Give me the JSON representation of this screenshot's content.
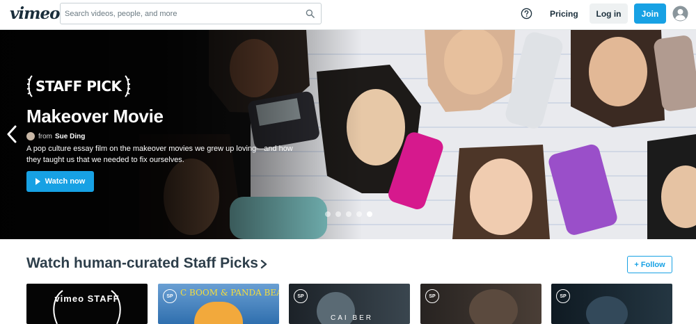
{
  "header": {
    "logo": "vimeo",
    "search_placeholder": "Search videos, people, and more",
    "pricing": "Pricing",
    "login": "Log in",
    "join": "Join"
  },
  "hero": {
    "badge": "STAFF PICK",
    "title": "Makeover Movie",
    "from_label": "from",
    "author": "Sue Ding",
    "description": "A pop culture essay film on the makeover movies we grew up loving—and how they taught us that we needed to fix ourselves.",
    "watch_label": "Watch now",
    "slide_count": 5,
    "active_slide": 5
  },
  "section": {
    "title": "Watch human-curated Staff Picks",
    "follow_label": "+ Follow"
  },
  "thumbnails": [
    {
      "badge": "",
      "caption": "vimeo STAFF",
      "background": "#050505"
    },
    {
      "badge": "SP",
      "caption": "C BOOM & PANDA BEAR",
      "background": "#2f6fae"
    },
    {
      "badge": "SP",
      "caption": "CAI BER",
      "background": "#1c2228"
    },
    {
      "badge": "SP",
      "caption": "",
      "background": "#272321"
    },
    {
      "badge": "SP",
      "caption": "",
      "background": "#0f1a22"
    }
  ],
  "colors": {
    "accent": "#17a1e4",
    "text": "#1a2e3b"
  },
  "icons": {
    "search": "search-icon",
    "help": "help-icon",
    "avatar": "user-avatar-icon",
    "prev": "chevron-left-icon"
  }
}
